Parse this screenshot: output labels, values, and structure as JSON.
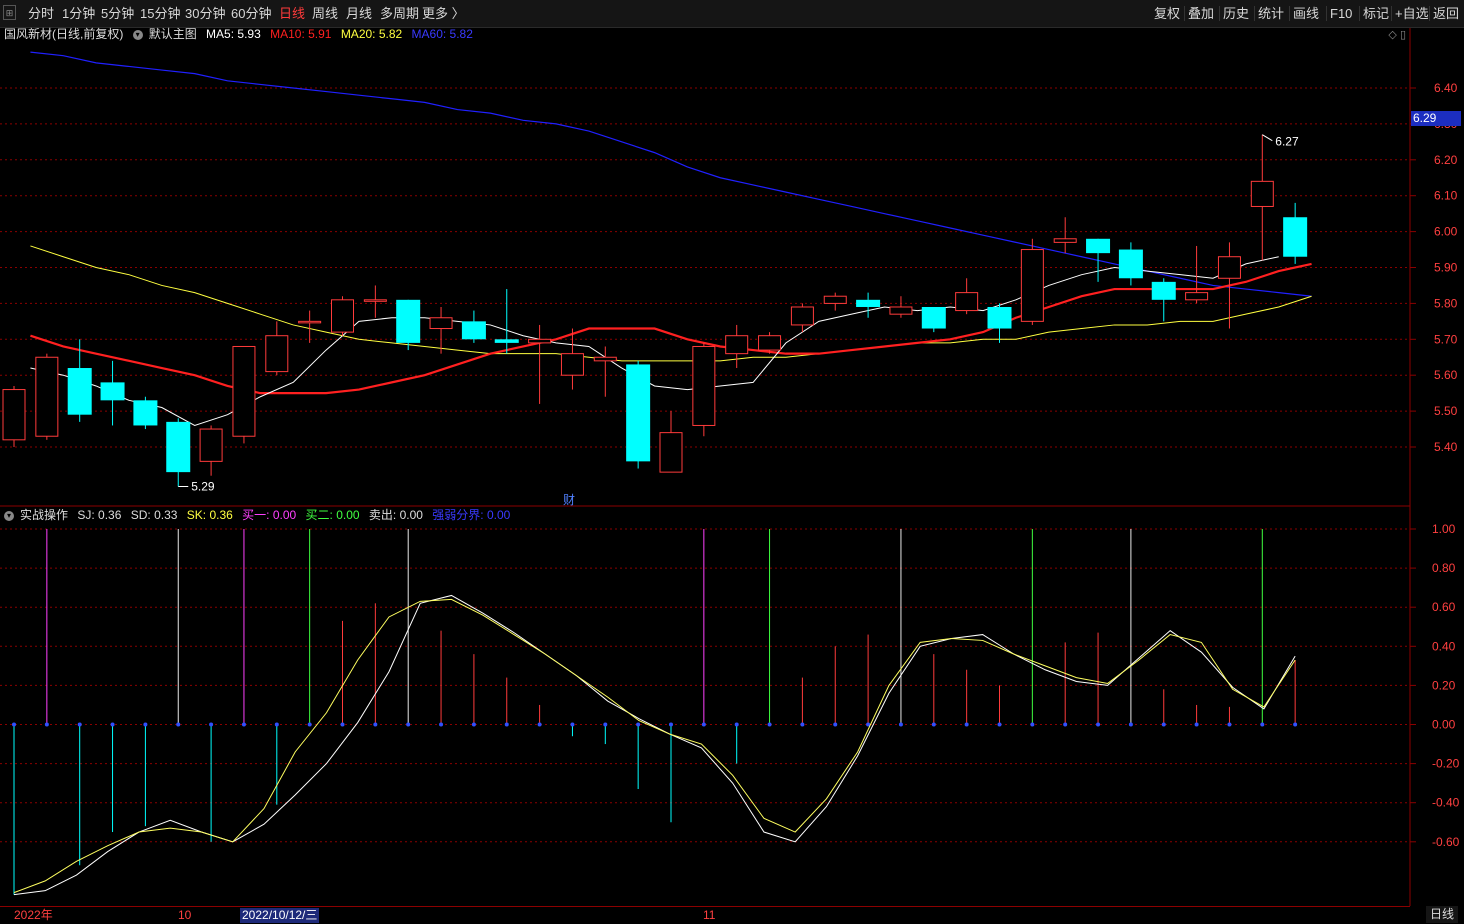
{
  "toolbar": {
    "periods": [
      "分时",
      "1分钟",
      "5分钟",
      "15分钟",
      "30分钟",
      "60分钟",
      "日线",
      "周线",
      "月线",
      "多周期",
      "更多 〉"
    ],
    "active_period": "日线",
    "right_buttons": [
      "复权",
      "叠加",
      "历史",
      "统计",
      "画线",
      "F10",
      "标记",
      "+自选",
      "返回"
    ]
  },
  "main_info": {
    "stock": "国风新材",
    "mode": "(日线,前复权)",
    "template": "默认主图",
    "ma5": "MA5: 5.93",
    "ma10": "MA10: 5.91",
    "ma20": "MA20: 5.82",
    "ma60": "MA60: 5.82"
  },
  "sub_info": {
    "name": "实战操作",
    "sj": "SJ: 0.36",
    "sd": "SD: 0.33",
    "sk": "SK: 0.36",
    "buy1": "买一: 0.00",
    "buy2": "买二: 0.00",
    "sell": "卖出: 0.00",
    "boundary": "强弱分界: 0.00"
  },
  "colors": {
    "up": "#ff3b3b",
    "down": "#00ffff",
    "ma5": "#ffffff",
    "ma10": "#ff2020",
    "ma20": "#ffff40",
    "ma60": "#2020ff",
    "buy1": "#ff40ff",
    "buy2": "#40ff40",
    "grid": "#8b0000"
  },
  "price_axis": [
    "6.40",
    "6.30",
    "6.20",
    "6.10",
    "6.00",
    "5.90",
    "5.80",
    "5.70",
    "5.60",
    "5.50",
    "5.40"
  ],
  "current_price_tag": "6.29",
  "annotations": {
    "high": "6.27",
    "low": "5.29",
    "cai": "财"
  },
  "sub_axis": [
    "1.00",
    "0.80",
    "0.60",
    "0.40",
    "0.20",
    "0.00",
    "-0.20",
    "-0.40",
    "-0.60"
  ],
  "dates": {
    "d1": "2022年",
    "d2": "10",
    "d3": "2022/10/12/三",
    "d4": "11"
  },
  "period_label": "日线",
  "chart_data": [
    {
      "type": "candlestick",
      "title": "",
      "ylim": [
        5.29,
        6.45
      ],
      "candles": [
        {
          "o": 5.42,
          "c": 5.56,
          "h": 5.57,
          "l": 5.4
        },
        {
          "o": 5.43,
          "c": 5.65,
          "h": 5.66,
          "l": 5.42
        },
        {
          "o": 5.62,
          "c": 5.49,
          "h": 5.7,
          "l": 5.47
        },
        {
          "o": 5.58,
          "c": 5.53,
          "h": 5.64,
          "l": 5.46
        },
        {
          "o": 5.53,
          "c": 5.46,
          "h": 5.54,
          "l": 5.45
        },
        {
          "o": 5.47,
          "c": 5.33,
          "h": 5.48,
          "l": 5.29
        },
        {
          "o": 5.36,
          "c": 5.45,
          "h": 5.46,
          "l": 5.32
        },
        {
          "o": 5.43,
          "c": 5.68,
          "h": 5.68,
          "l": 5.41
        },
        {
          "o": 5.61,
          "c": 5.71,
          "h": 5.75,
          "l": 5.6
        },
        {
          "o": 5.75,
          "c": 5.75,
          "h": 5.78,
          "l": 5.69
        },
        {
          "o": 5.72,
          "c": 5.81,
          "h": 5.82,
          "l": 5.71
        },
        {
          "o": 5.81,
          "c": 5.81,
          "h": 5.85,
          "l": 5.76
        },
        {
          "o": 5.81,
          "c": 5.69,
          "h": 5.81,
          "l": 5.67
        },
        {
          "o": 5.73,
          "c": 5.76,
          "h": 5.79,
          "l": 5.66
        },
        {
          "o": 5.75,
          "c": 5.7,
          "h": 5.78,
          "l": 5.69
        },
        {
          "o": 5.7,
          "c": 5.69,
          "h": 5.84,
          "l": 5.66
        },
        {
          "o": 5.69,
          "c": 5.7,
          "h": 5.74,
          "l": 5.52
        },
        {
          "o": 5.6,
          "c": 5.66,
          "h": 5.73,
          "l": 5.56
        },
        {
          "o": 5.64,
          "c": 5.65,
          "h": 5.68,
          "l": 5.54
        },
        {
          "o": 5.63,
          "c": 5.36,
          "h": 5.64,
          "l": 5.34
        },
        {
          "o": 5.33,
          "c": 5.44,
          "h": 5.5,
          "l": 5.33
        },
        {
          "o": 5.46,
          "c": 5.68,
          "h": 5.69,
          "l": 5.43
        },
        {
          "o": 5.66,
          "c": 5.71,
          "h": 5.74,
          "l": 5.62
        },
        {
          "o": 5.67,
          "c": 5.71,
          "h": 5.72,
          "l": 5.66
        },
        {
          "o": 5.74,
          "c": 5.79,
          "h": 5.8,
          "l": 5.72
        },
        {
          "o": 5.8,
          "c": 5.82,
          "h": 5.83,
          "l": 5.78
        },
        {
          "o": 5.81,
          "c": 5.79,
          "h": 5.83,
          "l": 5.76
        },
        {
          "o": 5.77,
          "c": 5.79,
          "h": 5.82,
          "l": 5.76
        },
        {
          "o": 5.79,
          "c": 5.73,
          "h": 5.79,
          "l": 5.72
        },
        {
          "o": 5.78,
          "c": 5.83,
          "h": 5.87,
          "l": 5.77
        },
        {
          "o": 5.79,
          "c": 5.73,
          "h": 5.8,
          "l": 5.69
        },
        {
          "o": 5.75,
          "c": 5.95,
          "h": 5.98,
          "l": 5.74
        },
        {
          "o": 5.97,
          "c": 5.98,
          "h": 6.04,
          "l": 5.94
        },
        {
          "o": 5.98,
          "c": 5.94,
          "h": 5.98,
          "l": 5.86
        },
        {
          "o": 5.95,
          "c": 5.87,
          "h": 5.97,
          "l": 5.85
        },
        {
          "o": 5.86,
          "c": 5.81,
          "h": 5.87,
          "l": 5.75
        },
        {
          "o": 5.81,
          "c": 5.83,
          "h": 5.96,
          "l": 5.8
        },
        {
          "o": 5.87,
          "c": 5.93,
          "h": 5.97,
          "l": 5.73
        },
        {
          "o": 6.07,
          "c": 6.14,
          "h": 6.27,
          "l": 5.92
        },
        {
          "o": 6.04,
          "c": 5.93,
          "h": 6.08,
          "l": 5.91
        }
      ],
      "ma5": [
        5.63,
        5.62,
        5.6,
        5.57,
        5.53,
        5.51,
        5.46,
        5.49,
        5.54,
        5.58,
        5.67,
        5.75,
        5.76,
        5.76,
        5.75,
        5.74,
        5.71,
        5.69,
        5.68,
        5.62,
        5.57,
        5.56,
        5.57,
        5.58,
        5.69,
        5.75,
        5.77,
        5.79,
        5.78,
        5.79,
        5.78,
        5.81,
        5.85,
        5.88,
        5.9,
        5.89,
        5.88,
        5.87,
        5.91,
        5.93
      ],
      "ma10": [
        5.74,
        5.71,
        5.68,
        5.66,
        5.64,
        5.62,
        5.6,
        5.57,
        5.55,
        5.55,
        5.55,
        5.56,
        5.58,
        5.6,
        5.63,
        5.66,
        5.68,
        5.7,
        5.73,
        5.73,
        5.73,
        5.7,
        5.68,
        5.67,
        5.66,
        5.66,
        5.67,
        5.68,
        5.69,
        5.7,
        5.72,
        5.76,
        5.79,
        5.82,
        5.84,
        5.84,
        5.84,
        5.84,
        5.86,
        5.89,
        5.91
      ],
      "ma20": [
        5.99,
        5.96,
        5.93,
        5.9,
        5.88,
        5.85,
        5.83,
        5.8,
        5.77,
        5.74,
        5.72,
        5.7,
        5.69,
        5.68,
        5.67,
        5.66,
        5.66,
        5.66,
        5.65,
        5.64,
        5.64,
        5.64,
        5.64,
        5.65,
        5.65,
        5.66,
        5.67,
        5.68,
        5.69,
        5.69,
        5.7,
        5.7,
        5.72,
        5.73,
        5.74,
        5.74,
        5.75,
        5.75,
        5.77,
        5.79,
        5.82
      ],
      "ma60": [
        6.52,
        6.5,
        6.49,
        6.47,
        6.46,
        6.45,
        6.44,
        6.42,
        6.41,
        6.4,
        6.39,
        6.38,
        6.37,
        6.36,
        6.34,
        6.33,
        6.31,
        6.3,
        6.28,
        6.25,
        6.22,
        6.18,
        6.15,
        6.13,
        6.11,
        6.09,
        6.07,
        6.05,
        6.03,
        6.01,
        5.99,
        5.97,
        5.95,
        5.93,
        5.91,
        5.89,
        5.87,
        5.85,
        5.84,
        5.83,
        5.82
      ]
    },
    {
      "type": "line",
      "title": "",
      "ylim": [
        -0.88,
        1.05
      ],
      "series": [
        {
          "name": "SJ",
          "values": [
            -0.87,
            -0.85,
            -0.77,
            -0.65,
            -0.55,
            -0.49,
            -0.55,
            -0.6,
            -0.51,
            -0.36,
            -0.2,
            0.01,
            0.27,
            0.62,
            0.66,
            0.57,
            0.47,
            0.36,
            0.25,
            0.12,
            0.03,
            -0.05,
            -0.12,
            -0.3,
            -0.55,
            -0.6,
            -0.42,
            -0.16,
            0.16,
            0.4,
            0.44,
            0.46,
            0.36,
            0.28,
            0.22,
            0.2,
            0.34,
            0.48,
            0.37,
            0.19,
            0.08,
            0.35
          ]
        },
        {
          "name": "SD",
          "values": [
            -0.86,
            -0.8,
            -0.7,
            -0.62,
            -0.55,
            -0.53,
            -0.55,
            -0.6,
            -0.43,
            -0.14,
            0.06,
            0.33,
            0.55,
            0.63,
            0.64,
            0.56,
            0.46,
            0.36,
            0.25,
            0.14,
            0.02,
            -0.05,
            -0.1,
            -0.26,
            -0.48,
            -0.55,
            -0.38,
            -0.14,
            0.2,
            0.42,
            0.44,
            0.43,
            0.36,
            0.3,
            0.24,
            0.21,
            0.33,
            0.46,
            0.42,
            0.18,
            0.09,
            0.33
          ]
        }
      ],
      "bars": [
        {
          "v": -0.87,
          "c": "down"
        },
        {
          "v": 1.0,
          "c": "buy1"
        },
        {
          "v": -0.72,
          "c": "down"
        },
        {
          "v": -0.55,
          "c": "down"
        },
        {
          "v": -0.52,
          "c": "down"
        },
        {
          "v": 1.0,
          "c": "buy0"
        },
        {
          "v": -0.6,
          "c": "down"
        },
        {
          "v": 1.0,
          "c": "buy1"
        },
        {
          "v": -0.41,
          "c": "down"
        },
        {
          "v": 1.0,
          "c": "buy2"
        },
        {
          "v": 0.53,
          "c": "up"
        },
        {
          "v": 0.62,
          "c": "up"
        },
        {
          "v": 1.0,
          "c": "buy0"
        },
        {
          "v": 0.48,
          "c": "up"
        },
        {
          "v": 0.36,
          "c": "up"
        },
        {
          "v": 0.24,
          "c": "up"
        },
        {
          "v": 0.1,
          "c": "up"
        },
        {
          "v": -0.06,
          "c": "down"
        },
        {
          "v": -0.1,
          "c": "down"
        },
        {
          "v": -0.33,
          "c": "down"
        },
        {
          "v": -0.5,
          "c": "down"
        },
        {
          "v": 1.0,
          "c": "buy1"
        },
        {
          "v": -0.2,
          "c": "down"
        },
        {
          "v": 1.0,
          "c": "buy2"
        },
        {
          "v": 0.24,
          "c": "up"
        },
        {
          "v": 0.4,
          "c": "up"
        },
        {
          "v": 0.46,
          "c": "up"
        },
        {
          "v": 1.0,
          "c": "buy0"
        },
        {
          "v": 0.36,
          "c": "up"
        },
        {
          "v": 0.28,
          "c": "up"
        },
        {
          "v": 0.2,
          "c": "up"
        },
        {
          "v": 1.0,
          "c": "buy2"
        },
        {
          "v": 0.42,
          "c": "up"
        },
        {
          "v": 0.47,
          "c": "up"
        },
        {
          "v": 1.0,
          "c": "buy0"
        },
        {
          "v": 0.18,
          "c": "up"
        },
        {
          "v": 0.1,
          "c": "up"
        },
        {
          "v": 0.09,
          "c": "up"
        },
        {
          "v": 1.0,
          "c": "buy2"
        },
        {
          "v": 0.33,
          "c": "up"
        }
      ]
    }
  ]
}
